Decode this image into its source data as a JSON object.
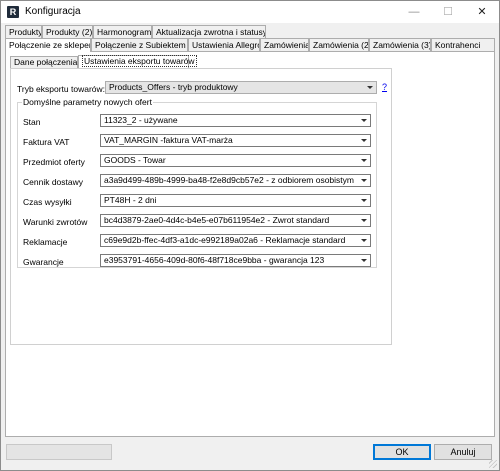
{
  "window": {
    "title": "Konfiguracja",
    "app_icon_letter": "R",
    "minimize": "—",
    "maximize": "☐",
    "close": "✕"
  },
  "tabs_row1": [
    {
      "label": "Produkty"
    },
    {
      "label": "Produkty (2)"
    },
    {
      "label": "Harmonogram"
    },
    {
      "label": "Aktualizacja zwrotna i statusy"
    }
  ],
  "tabs_row2": [
    {
      "label": "Połączenie ze sklepem",
      "active": true
    },
    {
      "label": "Połączenie z Subiektem"
    },
    {
      "label": "Ustawienia Allegro"
    },
    {
      "label": "Zamówienia"
    },
    {
      "label": "Zamówienia (2)"
    },
    {
      "label": "Zamówienia (3)"
    },
    {
      "label": "Kontrahenci"
    }
  ],
  "subtabs": [
    {
      "label": "Dane połączenia"
    },
    {
      "label": "Ustawienia eksportu towarów",
      "active": true
    }
  ],
  "export": {
    "label": "Tryb eksportu towarów:",
    "value": "Products_Offers - tryb produktowy",
    "help": "?"
  },
  "defaults": {
    "group_title": "Domyślne parametry nowych ofert",
    "fields": [
      {
        "label": "Stan",
        "value": "11323_2 - używane"
      },
      {
        "label": "Faktura VAT",
        "value": "VAT_MARGIN -faktura VAT-marża"
      },
      {
        "label": "Przedmiot oferty",
        "value": "GOODS - Towar"
      },
      {
        "label": "Cennik dostawy",
        "value": "a3a9d499-489b-4999-ba48-f2e8d9cb57e2 - z odbiorem osobistym"
      },
      {
        "label": "Czas wysyłki",
        "value": "PT48H - 2 dni"
      },
      {
        "label": "Warunki zwrotów",
        "value": "bc4d3879-2ae0-4d4c-b4e5-e07b611954e2 - Zwrot standard"
      },
      {
        "label": "Reklamacje",
        "value": "c69e9d2b-ffec-4df3-a1dc-e992189a02a6 - Reklamacje standard"
      },
      {
        "label": "Gwarancje",
        "value": "e3953791-4656-409d-80f6-48f718ce9bba - gwarancja 123"
      }
    ]
  },
  "buttons": {
    "ok": "OK",
    "cancel": "Anuluj"
  },
  "colors": {
    "accent": "#0078d7",
    "link": "#0000ee"
  }
}
